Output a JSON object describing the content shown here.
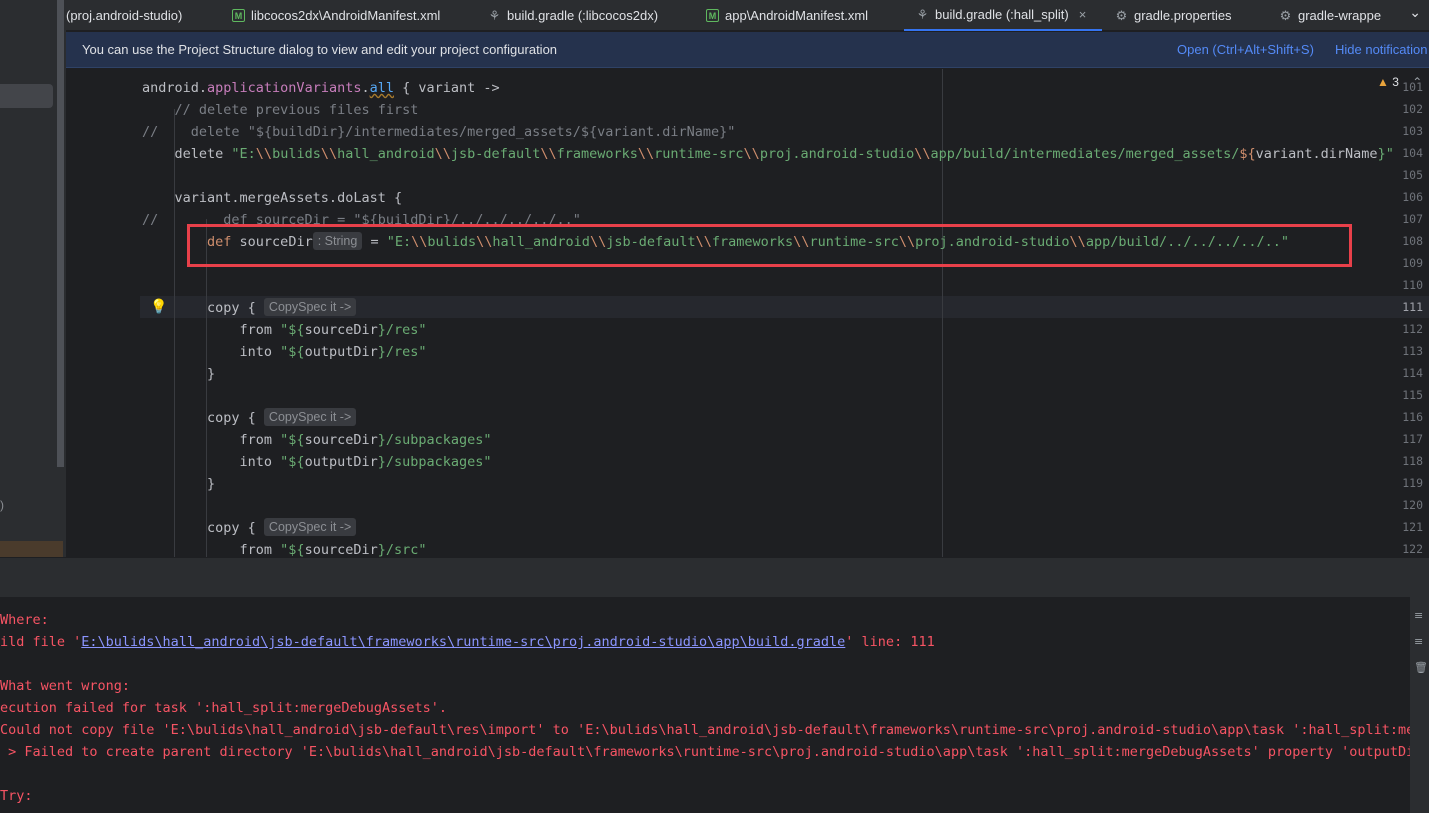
{
  "tabs": [
    {
      "label": "(proj.android-studio)",
      "icon": ""
    },
    {
      "label": "libcocos2dx\\AndroidManifest.xml",
      "icon": "manifest-icon"
    },
    {
      "label": "build.gradle (:libcocos2dx)",
      "icon": "gradle-icon"
    },
    {
      "label": "app\\AndroidManifest.xml",
      "icon": "manifest-icon"
    },
    {
      "label": "build.gradle (:hall_split)",
      "icon": "gradle-icon",
      "active": true,
      "close": "×"
    },
    {
      "label": "gradle.properties",
      "icon": "gear-icon"
    },
    {
      "label": "gradle-wrappe",
      "icon": "gear-icon"
    }
  ],
  "tab_overflow": "⌄",
  "banner": {
    "message": "You can use the Project Structure dialog to view and edit your project configuration",
    "open_link": "Open (Ctrl+Alt+Shift+S)",
    "hide_link": "Hide notification"
  },
  "editor": {
    "warnings_count": "3",
    "line_numbers": [
      "101",
      "102",
      "103",
      "104",
      "105",
      "106",
      "107",
      "108",
      "109",
      "110",
      "111",
      "112",
      "113",
      "114",
      "115",
      "116",
      "117",
      "118",
      "119",
      "120",
      "121",
      "122"
    ],
    "current_line": "111",
    "hint_string": ": String",
    "hint_copyspec": "CopySpec it ->",
    "lines": {
      "l101": [
        "android.",
        "applicationVariants",
        ".",
        "all",
        " { variant ->"
      ],
      "l102": "    // delete previous files first",
      "l103": [
        "//    ",
        "delete ",
        "\"${buildDir}/intermediates/merged_assets/${variant.dirName}\""
      ],
      "l104": [
        "    delete ",
        "\"E:",
        "\\\\",
        "bulids",
        "\\\\",
        "hall_android",
        "\\\\",
        "jsb-default",
        "\\\\",
        "frameworks",
        "\\\\",
        "runtime-src",
        "\\\\",
        "proj.android-studio",
        "\\\\",
        "app/build/intermediates/merged_assets/",
        "${",
        "variant.dirName",
        "}\""
      ],
      "l106": "    variant.mergeAssets.doLast {",
      "l107": [
        "//        ",
        "def sourceDir = \"${buildDir}/../../../../..\""
      ],
      "l108": [
        "        ",
        "def ",
        "sourceDir",
        " = ",
        "\"E:",
        "\\\\",
        "bulids",
        "\\\\",
        "hall_android",
        "\\\\",
        "jsb-default",
        "\\\\",
        "frameworks",
        "\\\\",
        "runtime-src",
        "\\\\",
        "proj.android-studio",
        "\\\\",
        "app/build/../../../../..\""
      ],
      "l111": "        copy { ",
      "l112": [
        "            from ",
        "\"${",
        "sourceDir",
        "}/res\""
      ],
      "l113": [
        "            into ",
        "\"${",
        "outputDir",
        "}/res\""
      ],
      "l114": "        }",
      "l116": "        copy { ",
      "l117": [
        "            from ",
        "\"${",
        "sourceDir",
        "}/subpackages\""
      ],
      "l118": [
        "            into ",
        "\"${",
        "outputDir",
        "}/subpackages\""
      ],
      "l119": "        }",
      "l121": "        copy { ",
      "l122": [
        "            from ",
        "\"${",
        "sourceDir",
        "}/src\""
      ]
    }
  },
  "console": {
    "line1": "Where:",
    "line2_prefix": "ild file '",
    "line2_link": "E:\\bulids\\hall_android\\jsb-default\\frameworks\\runtime-src\\proj.android-studio\\app\\build.gradle",
    "line2_suffix": "' line: 111",
    "line3": "What went wrong:",
    "line4": "ecution failed for task ':hall_split:mergeDebugAssets'.",
    "line5": "Could not copy file 'E:\\bulids\\hall_android\\jsb-default\\res\\import' to 'E:\\bulids\\hall_android\\jsb-default\\frameworks\\runtime-src\\proj.android-studio\\app\\task ':hall_split:merge",
    "line6": " > Failed to create parent directory 'E:\\bulids\\hall_android\\jsb-default\\frameworks\\runtime-src\\proj.android-studio\\app\\task ':hall_split:mergeDebugAssets' property 'outputDir''",
    "line7": "Try:"
  },
  "left_panel": {
    "paren": ")"
  },
  "colors": {
    "accent": "#3574f0",
    "highlight_box": "#e8404a",
    "error_text": "#f75464"
  }
}
